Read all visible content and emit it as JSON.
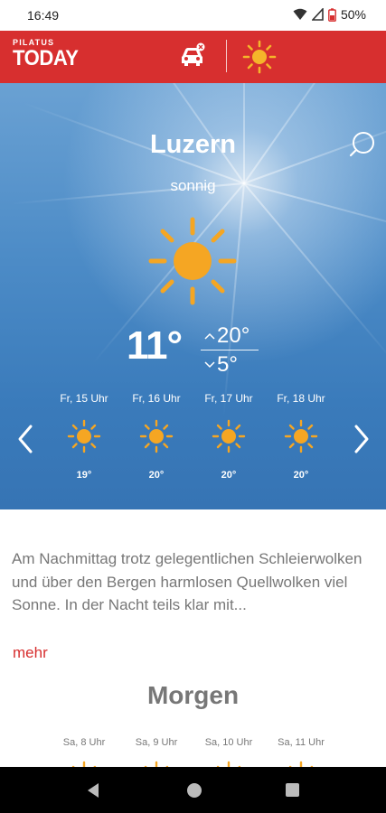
{
  "status_bar": {
    "time": "16:49",
    "battery": "50%"
  },
  "header": {
    "logo_small": "PILATUS",
    "logo_big": "TODAY"
  },
  "hero": {
    "city": "Luzern",
    "condition": "sonnig",
    "current_temp": "11°",
    "high_temp": "20°",
    "low_temp": "5°",
    "icon": "sun-icon"
  },
  "hourly": [
    {
      "time": "Fr, 15 Uhr",
      "temp": "19°",
      "icon": "sun-icon"
    },
    {
      "time": "Fr, 16 Uhr",
      "temp": "20°",
      "icon": "sun-icon"
    },
    {
      "time": "Fr, 17 Uhr",
      "temp": "20°",
      "icon": "sun-icon"
    },
    {
      "time": "Fr, 18 Uhr",
      "temp": "20°",
      "icon": "sun-icon"
    }
  ],
  "description": "Am Nachmittag trotz gelegentlichen Schleierwolken und über den Bergen harmlosen Quellwolken viel Sonne. In der Nacht teils klar mit...",
  "more_label": "mehr",
  "tomorrow": {
    "title": "Morgen",
    "hours": [
      {
        "time": "Sa, 8 Uhr"
      },
      {
        "time": "Sa, 9 Uhr"
      },
      {
        "time": "Sa, 10 Uhr"
      },
      {
        "time": "Sa, 11 Uhr"
      }
    ]
  },
  "colors": {
    "brand_red": "#d72f2f",
    "sun": "#f5a623",
    "text_gray": "#777777"
  }
}
